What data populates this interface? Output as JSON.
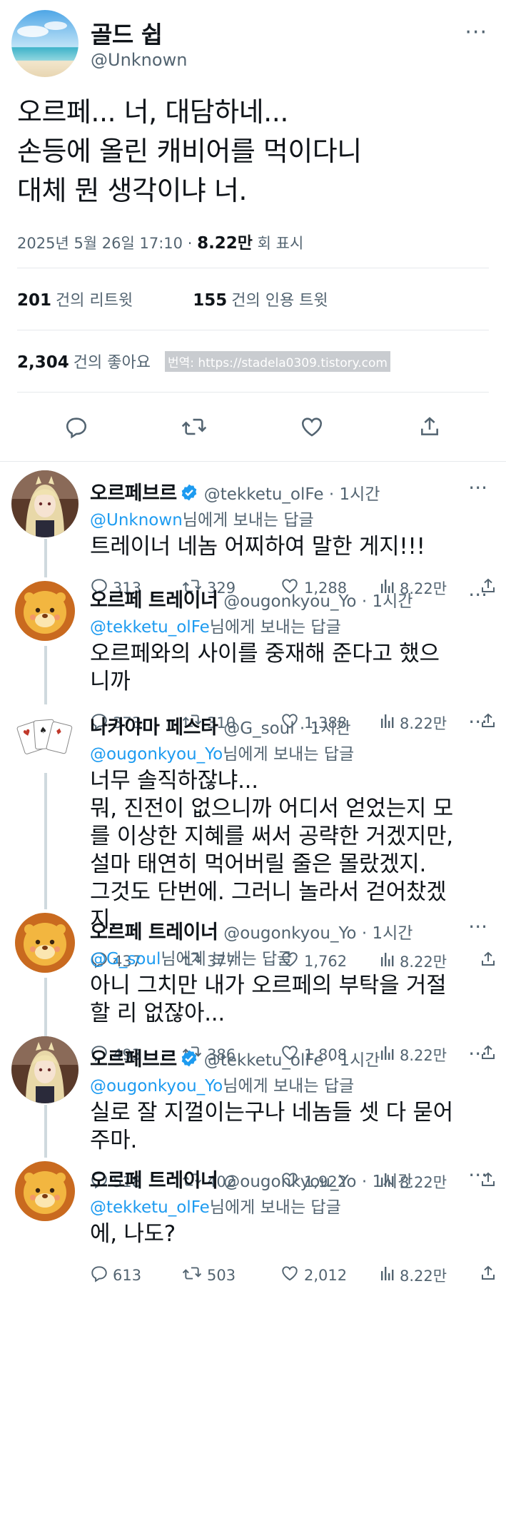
{
  "main_tweet": {
    "author_name": "골드 쉽",
    "author_handle": "@Unknown",
    "more": "···",
    "text_lines": [
      "오르페... 너, 대담하네...",
      "손등에 올린 캐비어를 먹이다니",
      "대체 뭔 생각이냐 너."
    ],
    "date": "2025년 5월 26일  17:10 · ",
    "views_count": "8.22만",
    "views_label": " 회 표시",
    "retweets": {
      "count": "201",
      "label": "건의 리트윗"
    },
    "quotes": {
      "count": "155",
      "label": "건의 인용 트윗"
    },
    "likes": {
      "count": "2,304",
      "label": "건의 좋아요"
    },
    "watermark": "번역: https://stadela0309.tistory.com"
  },
  "icons": {
    "reply": "reply-icon",
    "retweet": "retweet-icon",
    "like": "heart-icon",
    "views": "views-icon",
    "share": "share-icon",
    "verified": "verified-badge-icon"
  },
  "colors": {
    "link": "#1d9bf0",
    "secondary": "#536471",
    "verified": "#1d9bf0"
  },
  "replies": [
    {
      "name": "오르페브르",
      "verified": true,
      "handle": "@tekketu_olFe · 1시간",
      "reply_to_handle": "@Unknown",
      "reply_to_suffix": "님에게 보내는 답글",
      "lines": [
        "트레이너 네놈 어찌하여 말한 게지!!!"
      ],
      "replies": "313",
      "retweets": "329",
      "likes": "1,288",
      "views": "8.22만"
    },
    {
      "name": "오르페 트레이너",
      "verified": false,
      "handle": "@ougonkyou_Yo · 1시간",
      "reply_to_handle": "@tekketu_olFe",
      "reply_to_suffix": "님에게 보내는 답글",
      "lines": [
        "오르페와의 사이를 중재해 준다고 했으",
        "니까"
      ],
      "replies": "373",
      "retweets": "310",
      "likes": "1,388",
      "views": "8.22만"
    },
    {
      "name": "나카야마 페스타",
      "verified": false,
      "handle": "@G_soul · 1시간",
      "reply_to_handle": "@ougonkyou_Yo",
      "reply_to_suffix": "님에게 보내는 답글",
      "lines": [
        "너무 솔직하잖냐...",
        "뭐, 진전이 없으니까 어디서 얻었는지 모",
        "를 이상한 지혜를 써서 공략한 거겠지만,",
        "설마 태연히 먹어버릴 줄은 몰랐겠지.",
        "그것도 단번에. 그러니 놀라서 걷어찼겠",
        "지."
      ],
      "replies": "437",
      "retweets": "377",
      "likes": "1,762",
      "views": "8.22만"
    },
    {
      "name": "오르페 트레이너",
      "verified": false,
      "handle": "@ougonkyou_Yo · 1시간",
      "reply_to_handle": "@G_soul",
      "reply_to_suffix": "님에게 보내는 답글",
      "lines": [
        "아니 그치만 내가 오르페의 부탁을 거절",
        "할 리 없잖아..."
      ],
      "replies": "493",
      "retweets": "386",
      "likes": "1,808",
      "views": "8.22만"
    },
    {
      "name": "오르페브르",
      "verified": true,
      "handle": "@tekketu_olFe · 1시간",
      "reply_to_handle": "@ougonkyou_Yo",
      "reply_to_suffix": "님에게 보내는 답글",
      "lines": [
        "실로 잘 지껄이는구나 네놈들 셋 다 묻어",
        "주마."
      ],
      "replies": "518",
      "retweets": "402",
      "likes": "1,922",
      "views": "8.22만"
    },
    {
      "name": "오르페 트레이너",
      "verified": false,
      "handle": "@ougonkyou_Yo · 1시간",
      "reply_to_handle": "@tekketu_olFe",
      "reply_to_suffix": "님에게 보내는 답글",
      "lines": [
        "에, 나도?"
      ],
      "replies": "613",
      "retweets": "503",
      "likes": "2,012",
      "views": "8.22만"
    }
  ]
}
